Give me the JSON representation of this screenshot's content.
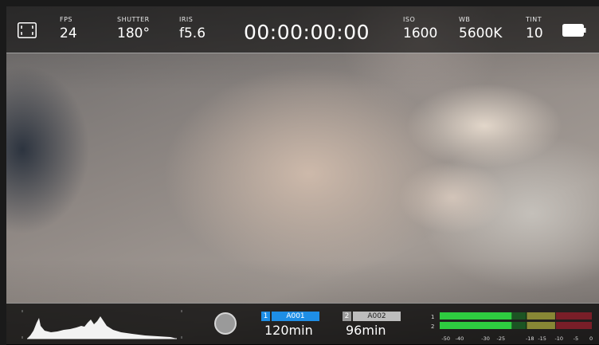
{
  "colors": {
    "slot1_accent": "#1e8ee6",
    "slot2_accent": "#bdbdbd",
    "meter_green": "#2ecc40",
    "meter_yellow": "#9a9a3a",
    "meter_red": "#8a1f2a"
  },
  "topbar": {
    "fullscreen_icon": "fullscreen-icon",
    "fps": {
      "label": "FPS",
      "value": "24"
    },
    "shutter": {
      "label": "SHUTTER",
      "value": "180°"
    },
    "iris": {
      "label": "IRIS",
      "value": "f5.6"
    },
    "timecode": "00:00:00:00",
    "iso": {
      "label": "ISO",
      "value": "1600"
    },
    "wb": {
      "label": "WB",
      "value": "5600K"
    },
    "tint": {
      "label": "TINT",
      "value": "10"
    },
    "battery_icon": "battery-icon"
  },
  "bottombar": {
    "histogram_icon": "histogram",
    "record_icon": "record-button",
    "slots": [
      {
        "number": "1",
        "name": "A001",
        "remaining": "120min"
      },
      {
        "number": "2",
        "name": "A002",
        "remaining": "96min"
      }
    ],
    "audio_meters": {
      "channels": [
        "1",
        "2"
      ],
      "levels_fraction": [
        0.47,
        0.47
      ],
      "scale_labels": [
        "-50",
        "-40",
        "-30",
        "-25",
        "-18",
        "-15",
        "-10",
        "-5",
        "0"
      ]
    }
  }
}
